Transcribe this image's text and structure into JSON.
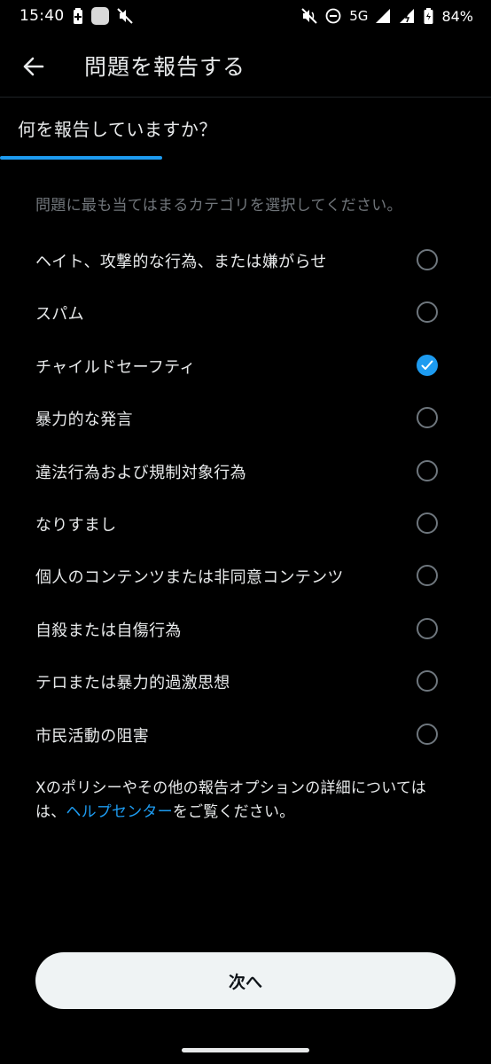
{
  "status_bar": {
    "time": "15:40",
    "network": "5G",
    "battery": "84%"
  },
  "header": {
    "title": "問題を報告する"
  },
  "section": {
    "heading": "何を報告していますか？"
  },
  "instruction": "問題に最も当てはまるカテゴリを選択してください。",
  "options": [
    {
      "label": "ヘイト、攻撃的な行為、または嫌がらせ",
      "selected": false
    },
    {
      "label": "スパム",
      "selected": false
    },
    {
      "label": "チャイルドセーフティ",
      "selected": true
    },
    {
      "label": "暴力的な発言",
      "selected": false
    },
    {
      "label": "違法行為および規制対象行為",
      "selected": false
    },
    {
      "label": "なりすまし",
      "selected": false
    },
    {
      "label": "個人のコンテンツまたは非同意コンテンツ",
      "selected": false
    },
    {
      "label": "自殺または自傷行為",
      "selected": false
    },
    {
      "label": "テロまたは暴力的過激思想",
      "selected": false
    },
    {
      "label": "市民活動の阻害",
      "selected": false
    }
  ],
  "footer": {
    "line1": "Xのポリシーやその他の報告オプションの詳細については",
    "line2_prefix": "は、",
    "link_text": "ヘルプセンター",
    "line2_suffix": "をご覧ください。"
  },
  "next_button": {
    "label": "次へ"
  },
  "colors": {
    "background": "#000000",
    "accent": "#1d9bf0",
    "text_primary": "#e7e9ea",
    "text_secondary": "#71767b",
    "button_bg": "#eff3f4"
  }
}
